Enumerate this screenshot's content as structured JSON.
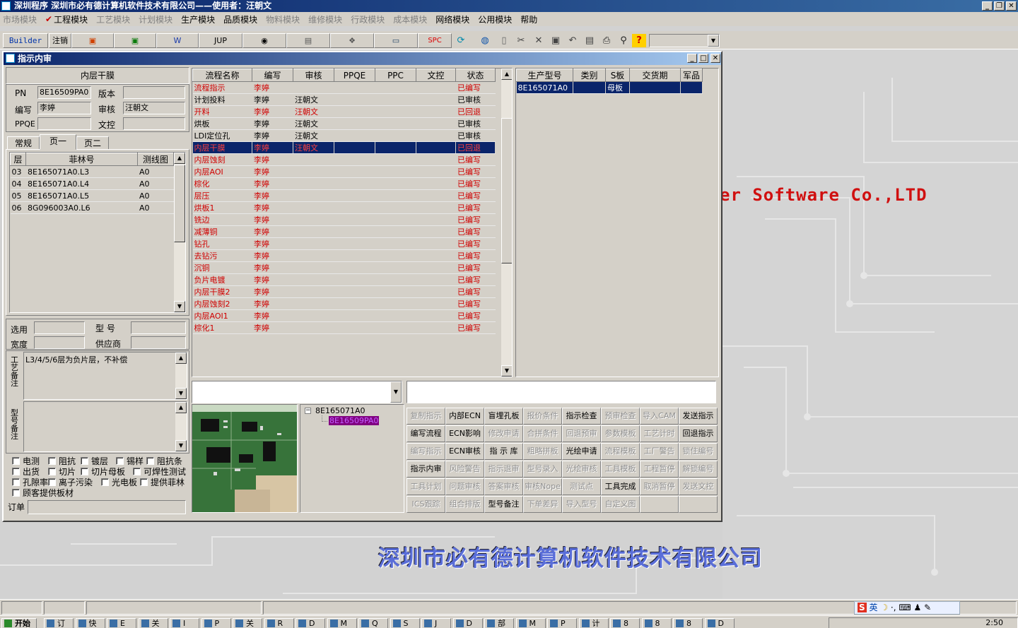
{
  "app": {
    "title": "深圳程序  深圳市必有德计算机软件技术有限公司——使用者：汪朝文"
  },
  "menu": [
    {
      "label": "市场模块",
      "disabled": true
    },
    {
      "label": "工程模块",
      "checked": true
    },
    {
      "label": "工艺模块",
      "disabled": true
    },
    {
      "label": "计划模块",
      "disabled": true
    },
    {
      "label": "生产模块"
    },
    {
      "label": "品质模块"
    },
    {
      "label": "物料模块",
      "disabled": true
    },
    {
      "label": "维修模块",
      "disabled": true
    },
    {
      "label": "行政模块",
      "disabled": true
    },
    {
      "label": "成本模块",
      "disabled": true
    },
    {
      "label": "网络模块"
    },
    {
      "label": "公用模块"
    },
    {
      "label": "帮助"
    }
  ],
  "toolbar": {
    "builder": "Builder",
    "logout": "注销",
    "jup": "JUP",
    "spc": "SPC",
    "icons": [
      "powerpoint-icon",
      "excel-icon",
      "word-icon",
      "eye-icon",
      "database-icon",
      "network-icon",
      "computer-icon",
      "refresh-icon",
      "globe-icon",
      "new-file-icon",
      "cut-icon",
      "delete-icon",
      "save-icon",
      "undo-icon",
      "preview-icon",
      "print-icon",
      "find-icon",
      "help-icon"
    ]
  },
  "window": {
    "title": "指示内审"
  },
  "left": {
    "section_title": "内层干膜",
    "pn_label": "PN",
    "pn": "8E16509PA0",
    "version_label": "版本",
    "version": "",
    "author_label": "编写",
    "author": "李婷",
    "reviewer_label": "审核",
    "reviewer": "汪朝文",
    "ppqe_label": "PPQE",
    "ppqe": "",
    "control_label": "文控",
    "control": "",
    "tabs": [
      "常规",
      "页一",
      "页二"
    ],
    "layer_table": {
      "headers": [
        "层",
        "菲林号",
        "测线图"
      ],
      "rows": [
        [
          "03",
          "8E165071A0.L3",
          "A0"
        ],
        [
          "04",
          "8E165071A0.L4",
          "A0"
        ],
        [
          "05",
          "8E165071A0.L5",
          "A0"
        ],
        [
          "06",
          "8G096003A0.L6",
          "A0"
        ]
      ]
    },
    "select_label": "选用",
    "model_label": "型 号",
    "width_label": "宽度",
    "supplier_label": "供应商",
    "process_note_label": "工艺备注",
    "process_note": "L3/4/5/6层为负片层，不补偿",
    "model_note_label": "型号备注",
    "checkboxes": [
      "电测",
      "阻抗",
      "镀层",
      "锡样",
      "阻抗条",
      "出货",
      "切片",
      "切片母板",
      "可焊性测试",
      "孔隙率",
      "离子污染",
      "光电板",
      "提供菲林",
      "顾客提供板材"
    ],
    "order_label": "订单"
  },
  "flow": {
    "headers": [
      "流程名称",
      "编写",
      "审核",
      "PPQE",
      "PPC",
      "文控",
      "状态"
    ],
    "rows": [
      {
        "name": "流程指示",
        "author": "李婷",
        "reviewer": "",
        "status": "已编写",
        "style": "red"
      },
      {
        "name": "计划投料",
        "author": "李婷",
        "reviewer": "汪朝文",
        "status": "已审核",
        "style": ""
      },
      {
        "name": "开料",
        "author": "李婷",
        "reviewer": "汪朝文",
        "status": "已回退",
        "style": "red"
      },
      {
        "name": "烘板",
        "author": "李婷",
        "reviewer": "汪朝文",
        "status": "已审核",
        "style": ""
      },
      {
        "name": "LDI定位孔",
        "author": "李婷",
        "reviewer": "汪朝文",
        "status": "已审核",
        "style": ""
      },
      {
        "name": "内层干膜",
        "author": "李婷",
        "reviewer": "汪朝文",
        "status": "已回退",
        "style": "sel"
      },
      {
        "name": "内层蚀刻",
        "author": "李婷",
        "reviewer": "",
        "status": "已编写",
        "style": "red"
      },
      {
        "name": "内层AOI",
        "author": "李婷",
        "reviewer": "",
        "status": "已编写",
        "style": "red"
      },
      {
        "name": "棕化",
        "author": "李婷",
        "reviewer": "",
        "status": "已编写",
        "style": "red"
      },
      {
        "name": "层压",
        "author": "李婷",
        "reviewer": "",
        "status": "已编写",
        "style": "red"
      },
      {
        "name": "烘板1",
        "author": "李婷",
        "reviewer": "",
        "status": "已编写",
        "style": "red"
      },
      {
        "name": "铣边",
        "author": "李婷",
        "reviewer": "",
        "status": "已编写",
        "style": "red"
      },
      {
        "name": "减薄铜",
        "author": "李婷",
        "reviewer": "",
        "status": "已编写",
        "style": "red"
      },
      {
        "name": "钻孔",
        "author": "李婷",
        "reviewer": "",
        "status": "已编写",
        "style": "red"
      },
      {
        "name": "去钻污",
        "author": "李婷",
        "reviewer": "",
        "status": "已编写",
        "style": "red"
      },
      {
        "name": "沉铜",
        "author": "李婷",
        "reviewer": "",
        "status": "已编写",
        "style": "red"
      },
      {
        "name": "负片电镀",
        "author": "李婷",
        "reviewer": "",
        "status": "已编写",
        "style": "red"
      },
      {
        "name": "内层干膜2",
        "author": "李婷",
        "reviewer": "",
        "status": "已编写",
        "style": "red"
      },
      {
        "name": "内层蚀刻2",
        "author": "李婷",
        "reviewer": "",
        "status": "已编写",
        "style": "red"
      },
      {
        "name": "内层AOI1",
        "author": "李婷",
        "reviewer": "",
        "status": "已编写",
        "style": "red"
      },
      {
        "name": "棕化1",
        "author": "李婷",
        "reviewer": "",
        "status": "已编写",
        "style": "red"
      }
    ]
  },
  "product": {
    "headers": [
      "生产型号",
      "类别",
      "S板",
      "交货期",
      "军品"
    ],
    "rows": [
      [
        "8E165071A0",
        "",
        "母板",
        "",
        ""
      ]
    ]
  },
  "tree": {
    "root": "8E165071A0",
    "child": "8E16509PA0"
  },
  "actions": [
    {
      "label": "复制指示",
      "disabled": true
    },
    {
      "label": "内部ECN"
    },
    {
      "label": "盲埋孔板"
    },
    {
      "label": "报价条件",
      "disabled": true
    },
    {
      "label": "指示检查"
    },
    {
      "label": "预审检查",
      "disabled": true
    },
    {
      "label": "导入CAM",
      "disabled": true
    },
    {
      "label": "发送指示"
    },
    {
      "label": "编写流程"
    },
    {
      "label": "ECN影响"
    },
    {
      "label": "修改申请",
      "disabled": true
    },
    {
      "label": "合拼条件",
      "disabled": true
    },
    {
      "label": "回退预审",
      "disabled": true
    },
    {
      "label": "参数模板",
      "disabled": true
    },
    {
      "label": "工艺计时",
      "disabled": true
    },
    {
      "label": "回退指示"
    },
    {
      "label": "编写指示",
      "disabled": true
    },
    {
      "label": "ECN审核"
    },
    {
      "label": "指 示 库"
    },
    {
      "label": "粗略拼板",
      "disabled": true
    },
    {
      "label": "光绘申请"
    },
    {
      "label": "流程模板",
      "disabled": true
    },
    {
      "label": "工厂警告",
      "disabled": true
    },
    {
      "label": "锁住编号",
      "disabled": true
    },
    {
      "label": "指示内审"
    },
    {
      "label": "风险警告",
      "disabled": true
    },
    {
      "label": "指示退审",
      "disabled": true
    },
    {
      "label": "型号录入",
      "disabled": true
    },
    {
      "label": "光绘审核",
      "disabled": true
    },
    {
      "label": "工具模板",
      "disabled": true
    },
    {
      "label": "工程暂停",
      "disabled": true
    },
    {
      "label": "解锁编号",
      "disabled": true
    },
    {
      "label": "工具计划",
      "disabled": true
    },
    {
      "label": "问题审核",
      "disabled": true
    },
    {
      "label": "答案审核",
      "disabled": true
    },
    {
      "label": "审核Nope",
      "disabled": true
    },
    {
      "label": "测试点",
      "disabled": true
    },
    {
      "label": "工具完成"
    },
    {
      "label": "取消暂停",
      "disabled": true
    },
    {
      "label": "发送文控",
      "disabled": true
    },
    {
      "label": "ICS跟踪",
      "disabled": true
    },
    {
      "label": "组合排版",
      "disabled": true
    },
    {
      "label": "型号备注"
    },
    {
      "label": "下单差异",
      "disabled": true
    },
    {
      "label": "导入型号",
      "disabled": true
    },
    {
      "label": "自定义图",
      "disabled": true
    },
    {
      "label": ""
    },
    {
      "label": ""
    }
  ],
  "background": {
    "brand_en": "er Software Co.,LTD",
    "brand_cn": "深圳市必有德计算机软件技术有限公司"
  },
  "taskbar": {
    "start": "开始",
    "clock": "2:50",
    "tasks": [
      "订",
      "快",
      "E",
      "关",
      "I",
      "P",
      "关",
      "R",
      "D",
      "M",
      "Q",
      "S",
      "J",
      "D",
      "部",
      "M",
      "P",
      "计",
      "8",
      "8",
      "8",
      "D"
    ],
    "ime": "英"
  }
}
